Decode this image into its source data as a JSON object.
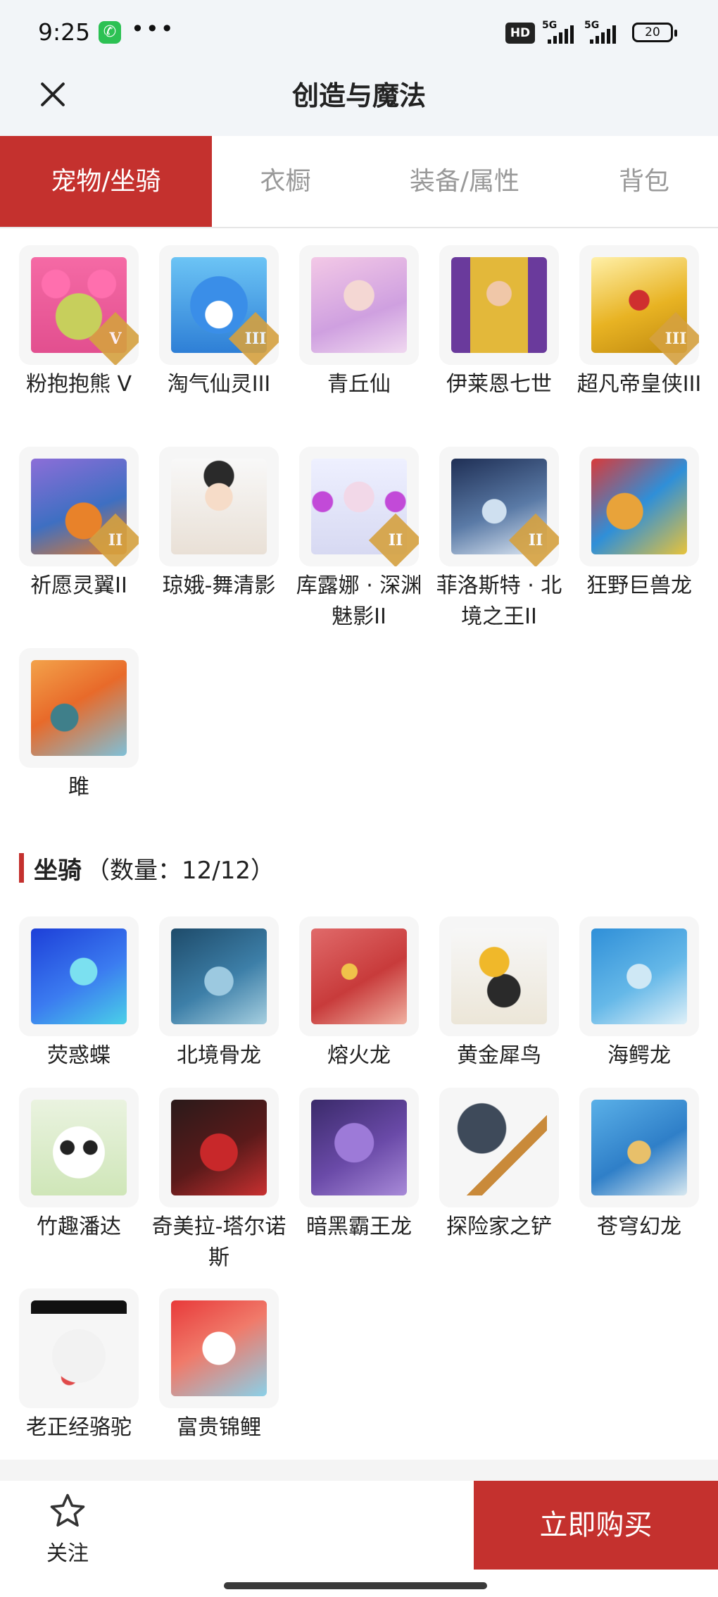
{
  "status_bar": {
    "time": "9:25",
    "network_1": "5G",
    "network_2": "5G",
    "hd": "HD",
    "battery": "20"
  },
  "nav": {
    "title": "创造与魔法"
  },
  "tabs": [
    {
      "label": "宠物/坐骑",
      "active": true
    },
    {
      "label": "衣橱",
      "active": false
    },
    {
      "label": "装备/属性",
      "active": false
    },
    {
      "label": "背包",
      "active": false
    }
  ],
  "pets": [
    {
      "name": "粉抱抱熊 V",
      "badge": "V",
      "icon": "pink-bear-icon"
    },
    {
      "name": "淘气仙灵III",
      "badge": "III",
      "icon": "blue-pup-icon"
    },
    {
      "name": "青丘仙",
      "badge": "",
      "icon": "fox-fairy-icon"
    },
    {
      "name": "伊莱恩七世",
      "badge": "",
      "icon": "pharaoh-icon"
    },
    {
      "name": "超凡帝皇侠III",
      "badge": "III",
      "icon": "golden-mecha-icon"
    },
    {
      "name": "祈愿灵翼II",
      "badge": "II",
      "icon": "griffin-icon"
    },
    {
      "name": "琼娥-舞清影",
      "badge": "",
      "icon": "dancer-icon"
    },
    {
      "name": "库露娜 · 深渊魅影II",
      "badge": "II",
      "icon": "white-spirit-icon"
    },
    {
      "name": "菲洛斯特 · 北境之王II",
      "badge": "II",
      "icon": "frost-king-icon"
    },
    {
      "name": "狂野巨兽龙",
      "badge": "",
      "icon": "wild-dragon-icon"
    },
    {
      "name": "雎",
      "badge": "",
      "icon": "phoenix-bird-icon"
    }
  ],
  "mounts_section": {
    "title": "坐骑",
    "count": "（数量：12/12）"
  },
  "mounts": [
    {
      "name": "荧惑蝶",
      "icon": "blue-butterfly-icon"
    },
    {
      "name": "北境骨龙",
      "icon": "bone-dragon-icon"
    },
    {
      "name": "熔火龙",
      "icon": "lava-dragon-icon"
    },
    {
      "name": "黄金犀鸟",
      "icon": "hornbill-icon"
    },
    {
      "name": "海鳄龙",
      "icon": "sea-dragon-icon"
    },
    {
      "name": "竹趣潘达",
      "icon": "panda-icon"
    },
    {
      "name": "奇美拉-塔尔诺斯",
      "icon": "chimera-icon"
    },
    {
      "name": "暗黑霸王龙",
      "icon": "dark-trex-icon"
    },
    {
      "name": "探险家之铲",
      "icon": "shovel-icon"
    },
    {
      "name": "苍穹幻龙",
      "icon": "sky-dragon-icon"
    },
    {
      "name": "老正经骆驼",
      "icon": "camel-icon"
    },
    {
      "name": "富贵锦鲤",
      "icon": "koi-icon"
    }
  ],
  "bottom_bar": {
    "follow_label": "关注",
    "buy_label": "立即购买"
  },
  "colors": {
    "accent": "#c4312e",
    "tab_inactive": "#999999",
    "tile_bg": "#f6f6f6"
  }
}
